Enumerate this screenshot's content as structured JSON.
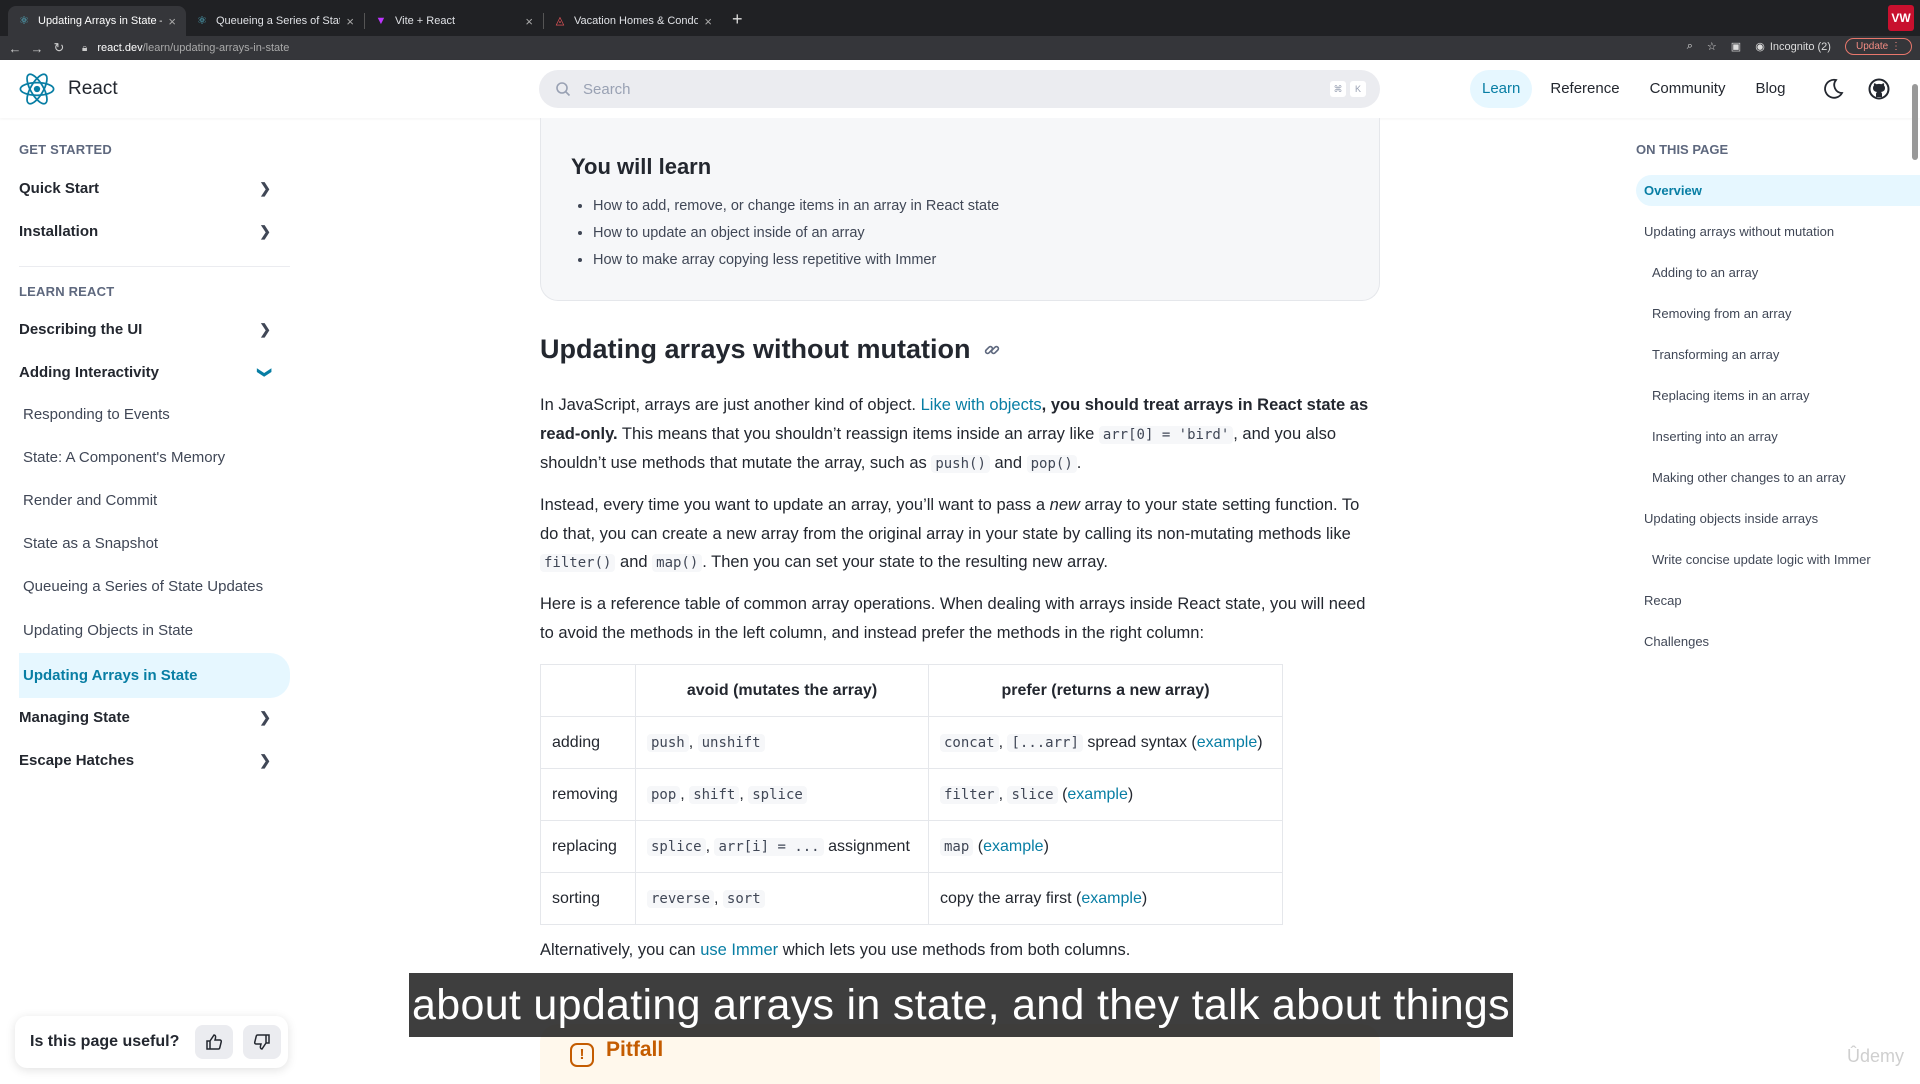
{
  "browser": {
    "tabs": [
      {
        "title": "Updating Arrays in State – React",
        "active": true,
        "icon": "react-icon"
      },
      {
        "title": "Queueing a Series of State Updates",
        "active": false,
        "icon": "react-icon"
      },
      {
        "title": "Vite + React",
        "active": false,
        "icon": "vite-icon"
      },
      {
        "title": "Vacation Homes & Condo Rentals",
        "active": false,
        "icon": "airbnb-icon"
      }
    ],
    "url_host": "react.dev",
    "url_path": "/learn/updating-arrays-in-state",
    "incognito_label": "Incognito (2)",
    "update_label": "Update",
    "profile_badge": "VW"
  },
  "topnav": {
    "logo_text": "React",
    "search_placeholder": "Search",
    "kbd1": "⌘",
    "kbd2": "K",
    "links": [
      "Learn",
      "Reference",
      "Community",
      "Blog"
    ],
    "active_link": "Learn"
  },
  "sidebar": {
    "get_started": "GET STARTED",
    "quick_start": "Quick Start",
    "installation": "Installation",
    "learn_react": "LEARN REACT",
    "describing_ui": "Describing the UI",
    "adding_interactivity": "Adding Interactivity",
    "sub_items": [
      "Responding to Events",
      "State: A Component's Memory",
      "Render and Commit",
      "State as a Snapshot",
      "Queueing a Series of State Updates",
      "Updating Objects in State",
      "Updating Arrays in State"
    ],
    "active_sub": "Updating Arrays in State",
    "managing_state": "Managing State",
    "escape_hatches": "Escape Hatches"
  },
  "main": {
    "learn_title": "You will learn",
    "learn_items": [
      "How to add, remove, or change items in an array in React state",
      "How to update an object inside of an array",
      "How to make array copying less repetitive with Immer"
    ],
    "heading": "Updating arrays without mutation",
    "p1": {
      "t1": "In JavaScript, arrays are just another kind of object. ",
      "link": "Like with objects",
      "bold": ", you should treat arrays in React state as read-only.",
      "t2": " This means that you shouldn’t reassign items inside an array like ",
      "code1": "arr[0] = 'bird'",
      "t3": ", and you also shouldn’t use methods that mutate the array, such as ",
      "code2": "push()",
      "t4": " and ",
      "code3": "pop()",
      "t5": "."
    },
    "p2": {
      "t1": "Instead, every time you want to update an array, you’ll want to pass a ",
      "em": "new",
      "t2": " array to your state setting function. To do that, you can create a new array from the original array in your state by calling its non-mutating methods like ",
      "code1": "filter()",
      "t3": " and ",
      "code2": "map()",
      "t4": ". Then you can set your state to the resulting new array."
    },
    "p3": "Here is a reference table of common array operations. When dealing with arrays inside React state, you will need to avoid the methods in the left column, and instead prefer the methods in the right column:",
    "table": {
      "headers": [
        "",
        "avoid (mutates the array)",
        "prefer (returns a new array)"
      ],
      "rows": [
        {
          "op": "adding",
          "avoid": [
            "push",
            "unshift"
          ],
          "avoid_suffix": "",
          "prefer_codes": [
            "concat",
            "[...arr]"
          ],
          "prefer_text": " spread syntax (",
          "link": "example",
          "close": ")"
        },
        {
          "op": "removing",
          "avoid": [
            "pop",
            "shift",
            "splice"
          ],
          "avoid_suffix": "",
          "prefer_codes": [
            "filter",
            "slice"
          ],
          "prefer_text": " (",
          "link": "example",
          "close": ")"
        },
        {
          "op": "replacing",
          "avoid": [
            "splice",
            "arr[i] = ..."
          ],
          "avoid_suffix": " assignment",
          "prefer_codes": [
            "map"
          ],
          "prefer_text": " (",
          "link": "example",
          "close": ")"
        },
        {
          "op": "sorting",
          "avoid": [
            "reverse",
            "sort"
          ],
          "avoid_suffix": "",
          "prefer_codes": [],
          "prefer_text": "copy the array first (",
          "link": "example",
          "close": ")"
        }
      ]
    },
    "p4": {
      "t1": "Alternatively, you can ",
      "link": "use Immer",
      "t2": " which lets you use methods from both columns."
    },
    "pitfall": "Pitfall"
  },
  "toc": {
    "title": "ON THIS PAGE",
    "items": [
      {
        "label": "Overview",
        "level": 1,
        "active": true
      },
      {
        "label": "Updating arrays without mutation",
        "level": 1
      },
      {
        "label": "Adding to an array",
        "level": 2
      },
      {
        "label": "Removing from an array",
        "level": 2
      },
      {
        "label": "Transforming an array",
        "level": 2
      },
      {
        "label": "Replacing items in an array",
        "level": 2
      },
      {
        "label": "Inserting into an array",
        "level": 2
      },
      {
        "label": "Making other changes to an array",
        "level": 2
      },
      {
        "label": "Updating objects inside arrays",
        "level": 1
      },
      {
        "label": "Write concise update logic with Immer",
        "level": 2
      },
      {
        "label": "Recap",
        "level": 1
      },
      {
        "label": "Challenges",
        "level": 1
      }
    ]
  },
  "feedback": {
    "question": "Is this page useful?"
  },
  "caption": "about updating arrays in state, and they talk about things",
  "watermark": "Ûdemy",
  "colors": {
    "accent": "#087ea4",
    "active_bg": "#e6f7ff",
    "pitfall": "#c45c00"
  }
}
